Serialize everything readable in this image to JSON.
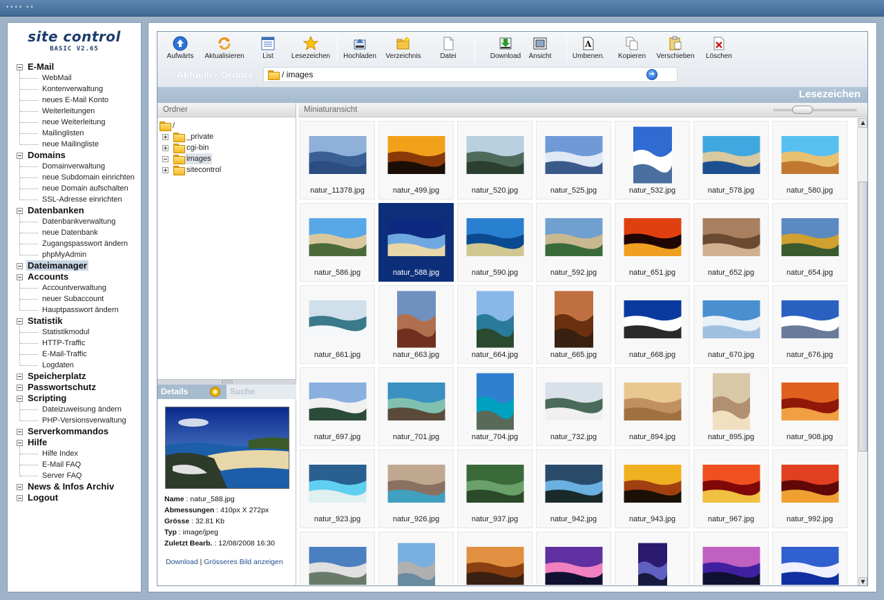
{
  "topbar": {
    "brand": "•••• ••"
  },
  "logo": {
    "title": "site control",
    "subtitle": "BASIC V2.65"
  },
  "nav": [
    {
      "label": "E-Mail",
      "items": [
        "WebMail",
        "Kontenverwaltung",
        "neues E-Mail Konto",
        "Weiterleitungen",
        "neue Weiterleitung",
        "Mailinglisten",
        "neue Mailingliste"
      ]
    },
    {
      "label": "Domains",
      "items": [
        "Domainverwaltung",
        "neue Subdomain einrichten",
        "neue Domain aufschalten",
        "SSL-Adresse einrichten"
      ]
    },
    {
      "label": "Datenbanken",
      "items": [
        "Datenbankverwaltung",
        "neue Datenbank",
        "Zugangspasswort ändern",
        "phpMyAdmin"
      ]
    },
    {
      "label": "Dateimanager",
      "items": [],
      "active": true
    },
    {
      "label": "Accounts",
      "items": [
        "Accountverwaltung",
        "neuer Subaccount",
        "Hauptpasswort ändern"
      ]
    },
    {
      "label": "Statistik",
      "items": [
        "Statistikmodul",
        "HTTP-Traffic",
        "E-Mail-Traffic",
        "Logdaten"
      ]
    },
    {
      "label": "Speicherplatz",
      "items": []
    },
    {
      "label": "Passwortschutz",
      "items": []
    },
    {
      "label": "Scripting",
      "items": [
        "Dateizuweisung ändern",
        "PHP-Versionsverwaltung"
      ]
    },
    {
      "label": "Serverkommandos",
      "items": []
    },
    {
      "label": "Hilfe",
      "items": [
        "Hilfe Index",
        "E-Mail FAQ",
        "Server FAQ"
      ]
    },
    {
      "label": "News & Infos Archiv",
      "items": []
    },
    {
      "label": "Logout",
      "items": []
    }
  ],
  "toolbar": {
    "buttons": [
      {
        "id": "up",
        "label": "Aufwärts",
        "icon": "arrow-up-icon"
      },
      {
        "id": "refresh",
        "label": "Aktualisieren",
        "icon": "refresh-icon"
      },
      {
        "id": "list",
        "label": "List",
        "icon": "list-icon"
      },
      {
        "id": "bookmarks",
        "label": "Lesezeichen",
        "icon": "star-icon"
      },
      {
        "id": "upload",
        "label": "Hochladen",
        "icon": "upload-icon"
      },
      {
        "id": "newdir",
        "label": "Verzeichnis",
        "icon": "new-folder-icon"
      },
      {
        "id": "newfile",
        "label": "Datei",
        "icon": "new-file-icon"
      },
      {
        "id": "download",
        "label": "Download",
        "icon": "download-icon"
      },
      {
        "id": "view",
        "label": "Ansicht",
        "icon": "view-icon"
      },
      {
        "id": "rename",
        "label": "Umbenen.",
        "icon": "rename-icon"
      },
      {
        "id": "copy",
        "label": "Kopieren",
        "icon": "copy-icon"
      },
      {
        "id": "move",
        "label": "Verschieben",
        "icon": "move-icon"
      },
      {
        "id": "delete",
        "label": "Löschen",
        "icon": "delete-icon"
      }
    ]
  },
  "folderbar": {
    "label": "Aktueller Ordner",
    "path": "/ images"
  },
  "bookmarkbar": {
    "label": "Lesezeichen"
  },
  "folders": {
    "header": "Ordner",
    "root": "/",
    "items": [
      {
        "label": "_private",
        "expanded": false
      },
      {
        "label": "cgi-bin",
        "expanded": false
      },
      {
        "label": "images",
        "expanded": true,
        "selected": true
      },
      {
        "label": "sitecontrol",
        "expanded": false
      }
    ]
  },
  "details": {
    "tab_active": "Details",
    "tab_inactive": "Suche",
    "name_label": "Name",
    "name": "natur_588.jpg",
    "dims_label": "Abmessungen",
    "dims": "410px X 272px",
    "size_label": "Grösse",
    "size": "32.81 Kb",
    "type_label": "Typ",
    "type": "image/jpeg",
    "modified_label": "Zuletzt Bearb.",
    "modified": "12/08/2008 16:30",
    "link_download": "Download",
    "link_separator": "|",
    "link_bigger": "Grösseres Bild anzeigen"
  },
  "thumbnails": {
    "header": "Miniaturansicht",
    "zoom_level": 0.3,
    "scroll_position": 0.12,
    "scroll_visible_fraction": 0.6,
    "selected": "natur_588.jpg",
    "files": [
      "natur_11378.jpg",
      "natur_499.jpg",
      "natur_520.jpg",
      "natur_525.jpg",
      "natur_532.jpg",
      "natur_578.jpg",
      "natur_580.jpg",
      "natur_586.jpg",
      "natur_588.jpg",
      "natur_590.jpg",
      "natur_592.jpg",
      "natur_651.jpg",
      "natur_652.jpg",
      "natur_654.jpg",
      "natur_661.jpg",
      "natur_663.jpg",
      "natur_664.jpg",
      "natur_665.jpg",
      "natur_668.jpg",
      "natur_670.jpg",
      "natur_676.jpg",
      "natur_697.jpg",
      "natur_701.jpg",
      "natur_704.jpg",
      "natur_732.jpg",
      "natur_894.jpg",
      "natur_895.jpg",
      "natur_908.jpg",
      "natur_923.jpg",
      "natur_926.jpg",
      "natur_937.jpg",
      "natur_942.jpg",
      "natur_943.jpg",
      "natur_967.jpg",
      "natur_992.jpg",
      "",
      "",
      "",
      "",
      "",
      "",
      ""
    ]
  },
  "colors": {
    "accent": "#1d3d6c",
    "selection": "#0d2f7a",
    "link": "#1f4d8a"
  }
}
